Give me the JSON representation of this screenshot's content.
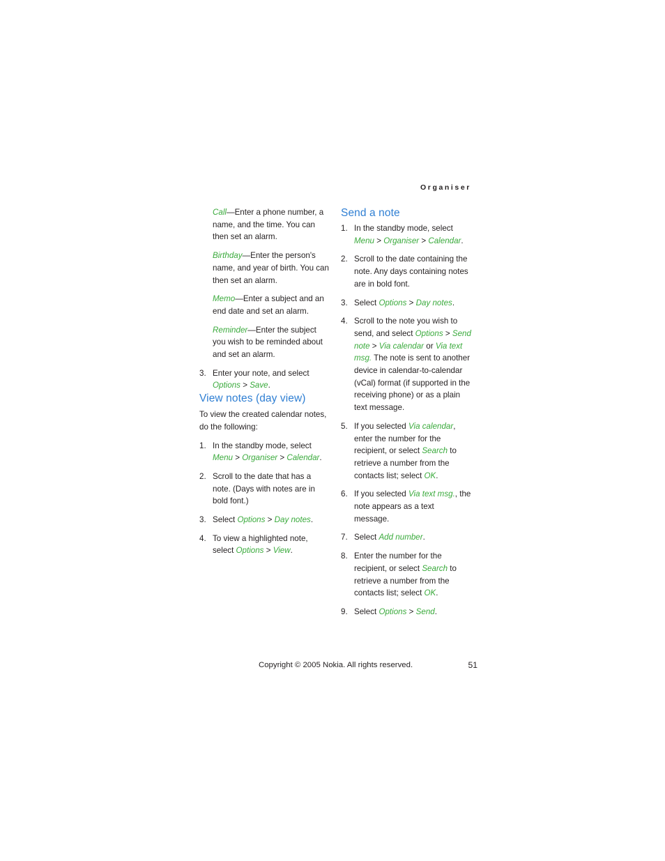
{
  "page": {
    "running_head": "Organiser",
    "number": "51",
    "copyright": "Copyright © 2005 Nokia. All rights reserved.",
    "heading_color": "#2f7fd3",
    "ui_term_color": "#3aaa3c",
    "text_color": "#231f20",
    "background_color": "#ffffff"
  },
  "left_column": {
    "definitions": [
      {
        "term": "Call",
        "dash": "—",
        "text": "Enter a phone number, a name, and the time. You can then set an alarm."
      },
      {
        "term": "Birthday",
        "dash": "—",
        "text": "Enter the person's name, and year of birth. You can then set an alarm."
      },
      {
        "term": "Memo",
        "dash": "—",
        "text": "Enter a subject and an end date and set an alarm."
      },
      {
        "term": "Reminder",
        "dash": "—",
        "text": "Enter the subject you wish to be reminded about and set an alarm."
      }
    ],
    "continued_step": {
      "num": "3.",
      "pre": "Enter your note, and select ",
      "ui1": "Options",
      "sep": " > ",
      "ui2": "Save",
      "post": "."
    },
    "section": {
      "heading": "View notes (day view)",
      "intro": "To view the created calendar notes, do the following:",
      "steps": [
        {
          "num": "1.",
          "parts": [
            {
              "t": "plain",
              "v": "In the standby mode, select "
            },
            {
              "t": "ui",
              "v": "Menu"
            },
            {
              "t": "plain",
              "v": " > "
            },
            {
              "t": "ui",
              "v": "Organiser"
            },
            {
              "t": "plain",
              "v": " > "
            },
            {
              "t": "ui",
              "v": "Calendar"
            },
            {
              "t": "plain",
              "v": "."
            }
          ],
          "plain_text": "In the standby mode, select Menu > Organiser > Calendar."
        },
        {
          "num": "2.",
          "plain_text": "Scroll to the date that has a note. (Days with notes are in bold font.)"
        },
        {
          "num": "3.",
          "plain_text": "Select Options > Day notes."
        },
        {
          "num": "4.",
          "plain_text": "To view a highlighted note, select Options > View."
        }
      ]
    }
  },
  "right_column": {
    "section": {
      "heading": "Send a note",
      "steps": [
        {
          "num": "1.",
          "plain_text": "In the standby mode, select Menu > Organiser > Calendar."
        },
        {
          "num": "2.",
          "plain_text": "Scroll to the date containing the note. Any days containing notes are in bold font."
        },
        {
          "num": "3.",
          "plain_text": "Select Options > Day notes."
        },
        {
          "num": "4.",
          "plain_text": "Scroll to the note you wish to send, and select Options > Send note > Via calendar or Via text msg. The note is sent to another device in calendar-to-calendar (vCal) format (if supported in the receiving phone) or as a plain text message."
        },
        {
          "num": "5.",
          "plain_text": "If you selected Via calendar, enter the number for the recipient, or select Search to retrieve a number from the contacts list; select OK."
        },
        {
          "num": "6.",
          "plain_text": "If you selected Via text msg., the note appears as a text message."
        },
        {
          "num": "7.",
          "plain_text": "Select Add number."
        },
        {
          "num": "8.",
          "plain_text": "Enter the number for the recipient, or select Search to retrieve a number from the contacts list; select OK."
        },
        {
          "num": "9.",
          "plain_text": "Select Options > Send."
        }
      ]
    },
    "terms": {
      "menu": "Menu",
      "organiser": "Organiser",
      "calendar": "Calendar",
      "options": "Options",
      "day_notes": "Day notes",
      "send_note": "Send note",
      "via_calendar": "Via calendar",
      "via_text_msg": "Via text msg.",
      "search": "Search",
      "ok": "OK",
      "add_number": "Add number",
      "send": "Send",
      "view": "View",
      "save": "Save"
    },
    "fragments": {
      "s1_a": "In the standby mode, select ",
      "s2": "Scroll to the date containing the note. Any days containing notes are in bold font.",
      "s3_a": "Select ",
      "s4_a": "Scroll to the note you wish to send, and select ",
      "s4_b": " or ",
      "s4_c": " The note is sent to another device in calendar-to-calendar (vCal) format (if supported in the receiving phone) or as a plain text message.",
      "s5_a": "If you selected ",
      "s5_b": ", enter the number for the recipient, or select ",
      "s5_c": " to retrieve a number from the contacts list; select ",
      "s6_a": "If you selected ",
      "s6_b": ", the note appears as a text message.",
      "s7_a": "Select ",
      "s8_a": "Enter the number for the recipient, or select ",
      "s8_b": " to retrieve a number from the contacts list; select ",
      "s9_a": "Select ",
      "gt": " > ",
      "period": "."
    }
  },
  "left_fragments": {
    "l1_a": "In the standby mode, select ",
    "l2": "Scroll to the date that has a note. (Days with notes are in bold font.)",
    "l3_a": "Select ",
    "l4_a": "To view a highlighted note, select ",
    "gt": " > ",
    "period": "."
  }
}
